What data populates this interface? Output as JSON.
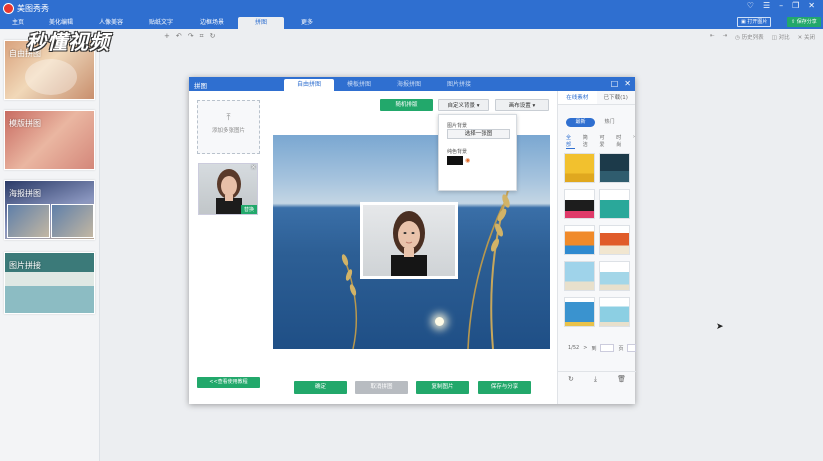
{
  "app": {
    "title": "美图秀秀",
    "tabs": [
      "主页",
      "美化编辑",
      "人像美容",
      "贴纸文字",
      "边框场景",
      "拼图",
      "更多"
    ],
    "active_tab": "拼图",
    "open_image": "打开图片",
    "save_share": "保存分享",
    "history": "历史列表",
    "compare": "对比",
    "close": "关闭"
  },
  "watermark": "秒懂视频",
  "sidebar": {
    "items": [
      "自由拼图",
      "模版拼图",
      "海报拼图",
      "图片拼接"
    ]
  },
  "dialog": {
    "title": "拼图",
    "tabs": [
      "自由拼图",
      "模板拼图",
      "海报拼图",
      "图片拼接"
    ],
    "active_tab": "自由拼图",
    "add_images": "添加多张图片",
    "replace": "替换",
    "help": "<<查看使用教程",
    "random_layout": "随机排版",
    "custom_bg": "自定义背景",
    "canvas_settings": "画布设置",
    "bg_popup": {
      "image_bg_label": "图片背景",
      "pick_image": "选择一张图",
      "solid_bg_label": "纯色背景",
      "solid_color": "#111111"
    },
    "buttons": {
      "ok": "确定",
      "cancel": "取消拼图",
      "copy": "复制图片",
      "save_share": "保存与分享"
    }
  },
  "material_panel": {
    "tabs": [
      "在线素材",
      "已下载(1)"
    ],
    "toggle": [
      "最新",
      "热门"
    ],
    "categories": [
      "全部",
      "简洁",
      "可爱",
      "时尚"
    ],
    "page_text": "1/52",
    "page_next": ">",
    "goto_label": "到",
    "page_suffix": "页"
  }
}
